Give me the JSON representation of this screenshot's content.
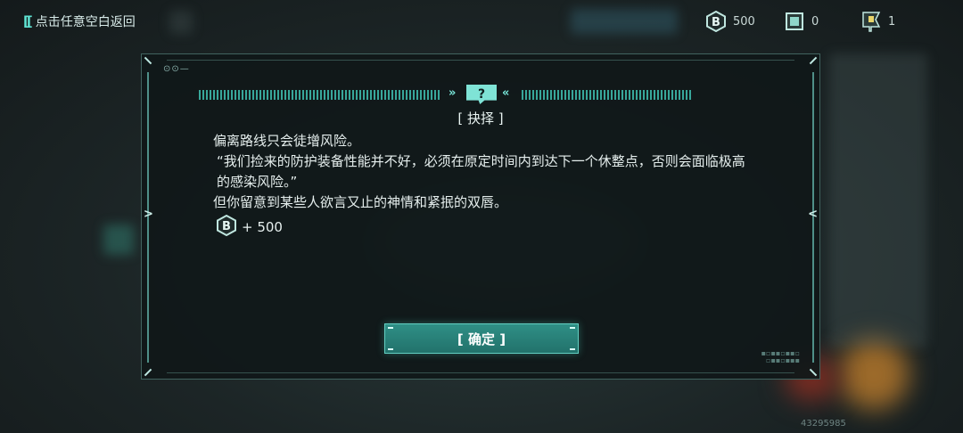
{
  "top_bar": {
    "back_label": "点击任意空白返回",
    "resources": [
      {
        "icon": "b-coin-icon",
        "value": "500"
      },
      {
        "icon": "chip-icon",
        "value": "0"
      },
      {
        "icon": "flag-icon",
        "value": "1"
      }
    ]
  },
  "dialog": {
    "title": "[ 抉择 ]",
    "paragraphs": [
      "偏离路线只会徒增风险。",
      "“我们捡来的防护装备性能并不好，必须在原定时间内到达下一个休整点，否则会面临极高的感染风险。”",
      "但你留意到某些人欲言又止的神情和紧抿的双唇。"
    ],
    "reward": {
      "icon": "b-coin-icon",
      "text": "+ 500"
    },
    "confirm_label": "[ 确定 ]"
  },
  "uid": "43295985",
  "colors": {
    "accent": "#5fe3d2",
    "button": "#2a837a",
    "panel": "#101819"
  }
}
